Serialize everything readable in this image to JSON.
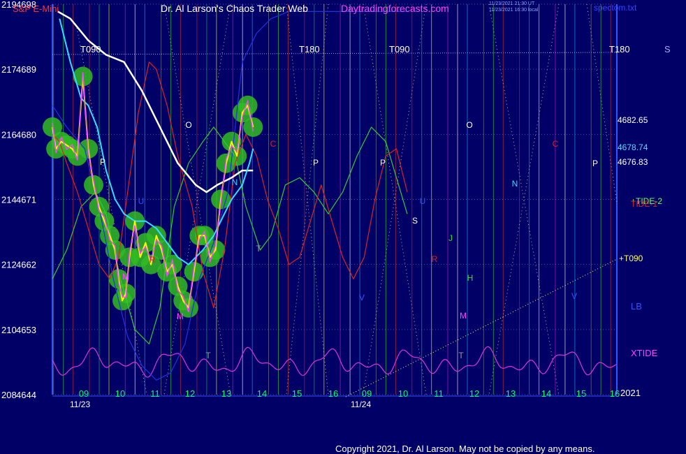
{
  "header": {
    "symbol": "S&P E-Mini",
    "title": "Dr. Al Larson's Chaos Trader Web",
    "site": "Daytradingforecasts.com",
    "stamp1": "11/23/2021 21:30 UT",
    "stamp2": "11/23/2021 16:30 local",
    "file": "spectom.txt"
  },
  "footer": {
    "copyright": "Copyright 2021, Dr. Al Larson. May not be copied by any means.",
    "year": "2021"
  },
  "colors": {
    "background": "#000066",
    "grid": "#3355cc",
    "price": "#ffff00",
    "fast_ma": "#ff44ff",
    "ma_cyan": "#33ddff",
    "ma_white": "#ffffff",
    "tide_red": "#dd2222",
    "tide_green": "#33cc33",
    "lb_blue": "#2233dd",
    "xtide": "#dd33dd",
    "bubbles": "#33bb22"
  },
  "chart_data": {
    "type": "line",
    "y_axis": {
      "range": [
        4644,
        4698
      ],
      "ticks": [
        {
          "index": "219",
          "price": 4698
        },
        {
          "index": "217",
          "price": 4689
        },
        {
          "index": "216",
          "price": 4680
        },
        {
          "index": "214",
          "price": 4671
        },
        {
          "index": "212",
          "price": 4662
        },
        {
          "index": "210",
          "price": 4653
        },
        {
          "index": "208",
          "price": 4644
        }
      ]
    },
    "x_axis": {
      "dates": [
        "11/23",
        "11/24"
      ],
      "hours_day1": [
        "09",
        "10",
        "11",
        "12",
        "13",
        "14",
        "15",
        "16"
      ],
      "hours_day2": [
        "09",
        "10",
        "11",
        "12",
        "13",
        "14",
        "15",
        "16"
      ]
    },
    "phase_labels": [
      "T090",
      "T180",
      "T090",
      "T180"
    ],
    "side_labels": {
      "s": "S",
      "p1": "4682.65",
      "p2": "4678.74",
      "p3": "4676.83",
      "tide2": "+TIDE-2",
      "tide1": "TIDE-1",
      "t090": "+T090",
      "lb": "LB",
      "xtide": "XTIDE"
    },
    "markers": [
      "P",
      "O",
      "N",
      "C",
      "P",
      "S",
      "U",
      "J",
      "R",
      "H",
      "M",
      "T",
      "O",
      "N",
      "P",
      "C",
      "V",
      "M",
      "P",
      "R",
      "T",
      "T",
      "V",
      "U",
      "M"
    ],
    "series": [
      {
        "name": "S&P E-Mini",
        "points": [
          [
            0.0,
            4681
          ],
          [
            0.1,
            4678
          ],
          [
            0.25,
            4679
          ],
          [
            0.4,
            4678.5
          ],
          [
            0.55,
            4678
          ],
          [
            0.7,
            4677
          ],
          [
            0.85,
            4688
          ],
          [
            1.0,
            4678
          ],
          [
            1.15,
            4673
          ],
          [
            1.3,
            4670
          ],
          [
            1.45,
            4668
          ],
          [
            1.6,
            4666
          ],
          [
            1.75,
            4664
          ],
          [
            1.85,
            4660
          ],
          [
            1.95,
            4657
          ],
          [
            2.05,
            4658
          ],
          [
            2.15,
            4663
          ],
          [
            2.3,
            4668
          ],
          [
            2.45,
            4663
          ],
          [
            2.6,
            4665
          ],
          [
            2.75,
            4662
          ],
          [
            2.9,
            4666
          ],
          [
            3.05,
            4664
          ],
          [
            3.2,
            4661
          ],
          [
            3.35,
            4662
          ],
          [
            3.5,
            4659
          ],
          [
            3.65,
            4657
          ],
          [
            3.8,
            4656
          ],
          [
            3.95,
            4661
          ],
          [
            4.1,
            4666
          ],
          [
            4.25,
            4666
          ],
          [
            4.4,
            4663
          ],
          [
            4.55,
            4664
          ],
          [
            4.7,
            4671
          ],
          [
            4.85,
            4676
          ],
          [
            5.0,
            4679
          ],
          [
            5.15,
            4677
          ],
          [
            5.3,
            4683
          ],
          [
            5.45,
            4684
          ],
          [
            5.6,
            4681
          ]
        ]
      },
      {
        "name": "White",
        "points": [
          [
            0.15,
            4697
          ],
          [
            0.5,
            4696
          ],
          [
            1.0,
            4693
          ],
          [
            1.5,
            4691
          ],
          [
            2.0,
            4690
          ],
          [
            2.5,
            4686
          ],
          [
            3.0,
            4681
          ],
          [
            3.5,
            4676
          ],
          [
            4.0,
            4673
          ],
          [
            4.3,
            4672
          ],
          [
            4.6,
            4673
          ],
          [
            5.0,
            4674
          ],
          [
            5.3,
            4675
          ],
          [
            5.6,
            4675
          ]
        ]
      },
      {
        "name": "Cyan",
        "points": [
          [
            0.2,
            4696
          ],
          [
            0.5,
            4690
          ],
          [
            0.8,
            4685
          ],
          [
            1.0,
            4684
          ],
          [
            1.25,
            4681
          ],
          [
            1.5,
            4675
          ],
          [
            1.75,
            4671
          ],
          [
            2.0,
            4669
          ],
          [
            2.3,
            4668
          ],
          [
            2.6,
            4668
          ],
          [
            2.9,
            4667
          ],
          [
            3.2,
            4665
          ],
          [
            3.5,
            4663
          ],
          [
            3.8,
            4662
          ],
          [
            4.0,
            4663
          ],
          [
            4.2,
            4664
          ],
          [
            4.5,
            4666
          ],
          [
            4.8,
            4669
          ],
          [
            5.0,
            4671
          ],
          [
            5.3,
            4673
          ],
          [
            5.5,
            4676
          ],
          [
            5.6,
            4678
          ]
        ]
      },
      {
        "name": "TIDE-1",
        "points": [
          [
            0.0,
            4680
          ],
          [
            0.2,
            4679
          ],
          [
            0.4,
            4676
          ],
          [
            0.7,
            4672
          ],
          [
            1.0,
            4667
          ],
          [
            1.3,
            4662
          ],
          [
            1.6,
            4660
          ],
          [
            1.85,
            4663
          ],
          [
            2.1,
            4672
          ],
          [
            2.4,
            4683
          ],
          [
            2.7,
            4690
          ],
          [
            2.9,
            4689
          ],
          [
            3.2,
            4684
          ],
          [
            3.5,
            4677
          ],
          [
            3.9,
            4670
          ],
          [
            4.2,
            4661
          ],
          [
            4.5,
            4656
          ],
          [
            4.8,
            4664
          ],
          [
            5.1,
            4676
          ],
          [
            5.4,
            4680
          ],
          [
            5.7,
            4677
          ],
          [
            6.0,
            4671
          ],
          [
            6.3,
            4667
          ],
          [
            6.6,
            4662
          ],
          [
            6.9,
            4663
          ],
          [
            7.2,
            4668
          ],
          [
            7.5,
            4673
          ],
          [
            7.8,
            4668
          ],
          [
            8.1,
            4663
          ],
          [
            8.4,
            4660
          ],
          [
            8.7,
            4663
          ],
          [
            9.0,
            4671
          ],
          [
            9.3,
            4677
          ],
          [
            9.6,
            4678
          ],
          [
            9.9,
            4672
          ]
        ]
      },
      {
        "name": "TIDE-2",
        "points": [
          [
            0.0,
            4660
          ],
          [
            0.4,
            4664
          ],
          [
            0.8,
            4670
          ],
          [
            1.2,
            4672
          ],
          [
            1.5,
            4669
          ],
          [
            1.9,
            4660
          ],
          [
            2.3,
            4653
          ],
          [
            2.7,
            4651
          ],
          [
            3.0,
            4656
          ],
          [
            3.4,
            4670
          ],
          [
            3.8,
            4676
          ],
          [
            4.2,
            4679
          ],
          [
            4.5,
            4681
          ],
          [
            4.8,
            4679
          ],
          [
            5.1,
            4677
          ],
          [
            5.4,
            4670
          ],
          [
            5.8,
            4664
          ],
          [
            6.1,
            4666
          ],
          [
            6.5,
            4673
          ],
          [
            6.9,
            4674
          ],
          [
            7.3,
            4672
          ],
          [
            7.7,
            4669
          ],
          [
            8.1,
            4672
          ],
          [
            8.5,
            4677
          ],
          [
            8.9,
            4681
          ],
          [
            9.3,
            4679
          ],
          [
            9.6,
            4674
          ],
          [
            9.9,
            4669
          ]
        ]
      },
      {
        "name": "LB",
        "points": [
          [
            0.0,
            4684
          ],
          [
            0.4,
            4681
          ],
          [
            0.9,
            4678
          ],
          [
            1.3,
            4670
          ],
          [
            1.7,
            4660
          ],
          [
            2.1,
            4652
          ],
          [
            2.5,
            4648
          ],
          [
            2.9,
            4646
          ],
          [
            3.3,
            4647
          ],
          [
            3.7,
            4651
          ],
          [
            4.1,
            4660
          ],
          [
            4.5,
            4665
          ],
          [
            4.9,
            4672
          ],
          [
            5.3,
            4690
          ],
          [
            5.7,
            4694
          ],
          [
            6.1,
            4696
          ],
          [
            6.6,
            4697
          ],
          [
            7.1,
            4697
          ],
          [
            7.6,
            4697
          ],
          [
            8.1,
            4697
          ],
          [
            8.6,
            4697
          ],
          [
            9.1,
            4697
          ],
          [
            9.6,
            4697
          ],
          [
            9.9,
            4697
          ]
        ]
      }
    ]
  }
}
